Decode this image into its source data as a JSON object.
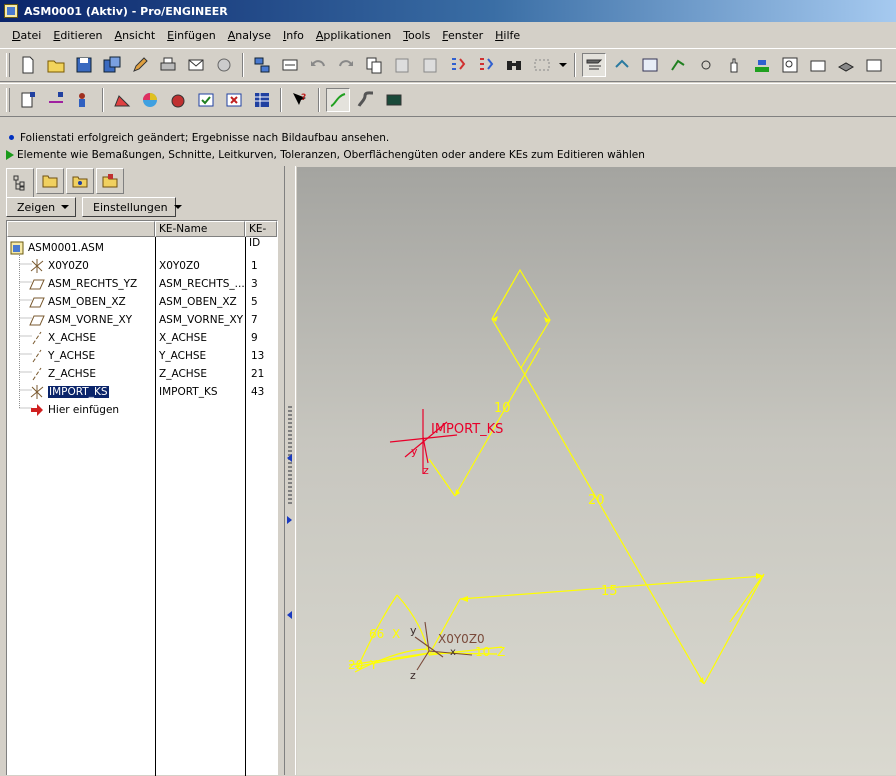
{
  "window": {
    "title": "ASM0001 (Aktiv) - Pro/ENGINEER"
  },
  "menu": [
    "Datei",
    "Editieren",
    "Ansicht",
    "Einfügen",
    "Analyse",
    "Info",
    "Applikationen",
    "Tools",
    "Fenster",
    "Hilfe"
  ],
  "messages": [
    "Folienstati erfolgreich geändert; Ergebnisse nach Bildaufbau ansehen.",
    "Elemente wie Bemaßungen, Schnitte, Leitkurven, Toleranzen, Oberflächengüten oder andere KEs zum Editieren wählen"
  ],
  "panel": {
    "show_button": "Zeigen",
    "settings_button": "Einstellungen",
    "columns": [
      "",
      "KE-Name",
      "KE-ID"
    ],
    "root": "ASM0001.ASM",
    "items": [
      {
        "label": "X0Y0Z0",
        "name": "X0Y0Z0",
        "id": "1",
        "icon": "csys-icon"
      },
      {
        "label": "ASM_RECHTS_YZ",
        "name": "ASM_RECHTS_...",
        "id": "3",
        "icon": "datum-plane-icon"
      },
      {
        "label": "ASM_OBEN_XZ",
        "name": "ASM_OBEN_XZ",
        "id": "5",
        "icon": "datum-plane-icon"
      },
      {
        "label": "ASM_VORNE_XY",
        "name": "ASM_VORNE_XY",
        "id": "7",
        "icon": "datum-plane-icon"
      },
      {
        "label": "X_ACHSE",
        "name": "X_ACHSE",
        "id": "9",
        "icon": "datum-axis-icon"
      },
      {
        "label": "Y_ACHSE",
        "name": "Y_ACHSE",
        "id": "13",
        "icon": "datum-axis-icon"
      },
      {
        "label": "Z_ACHSE",
        "name": "Z_ACHSE",
        "id": "21",
        "icon": "datum-axis-icon"
      },
      {
        "label": "IMPORT_KS",
        "name": "IMPORT_KS",
        "id": "43",
        "icon": "csys-icon",
        "selected": true
      }
    ],
    "insert_here": "Hier einfügen"
  },
  "viewport": {
    "dims": {
      "d10": "10",
      "d20": "20",
      "d15": "15",
      "a66": "66",
      "a20": "20",
      "d10b": "10"
    },
    "labels": {
      "import_ks": "IMPORT_KS",
      "x0y0z0": "X0Y0Z0",
      "y": "y",
      "z": "z",
      "x": "x",
      "dimX": "X",
      "dimY": "Y",
      "dimZ": "Z",
      "red_y": "y",
      "red_z": "z"
    },
    "colors": {
      "dimension": "#ffff00",
      "csys_selected": "#e8002a",
      "csys": "#7a4a3a"
    }
  }
}
